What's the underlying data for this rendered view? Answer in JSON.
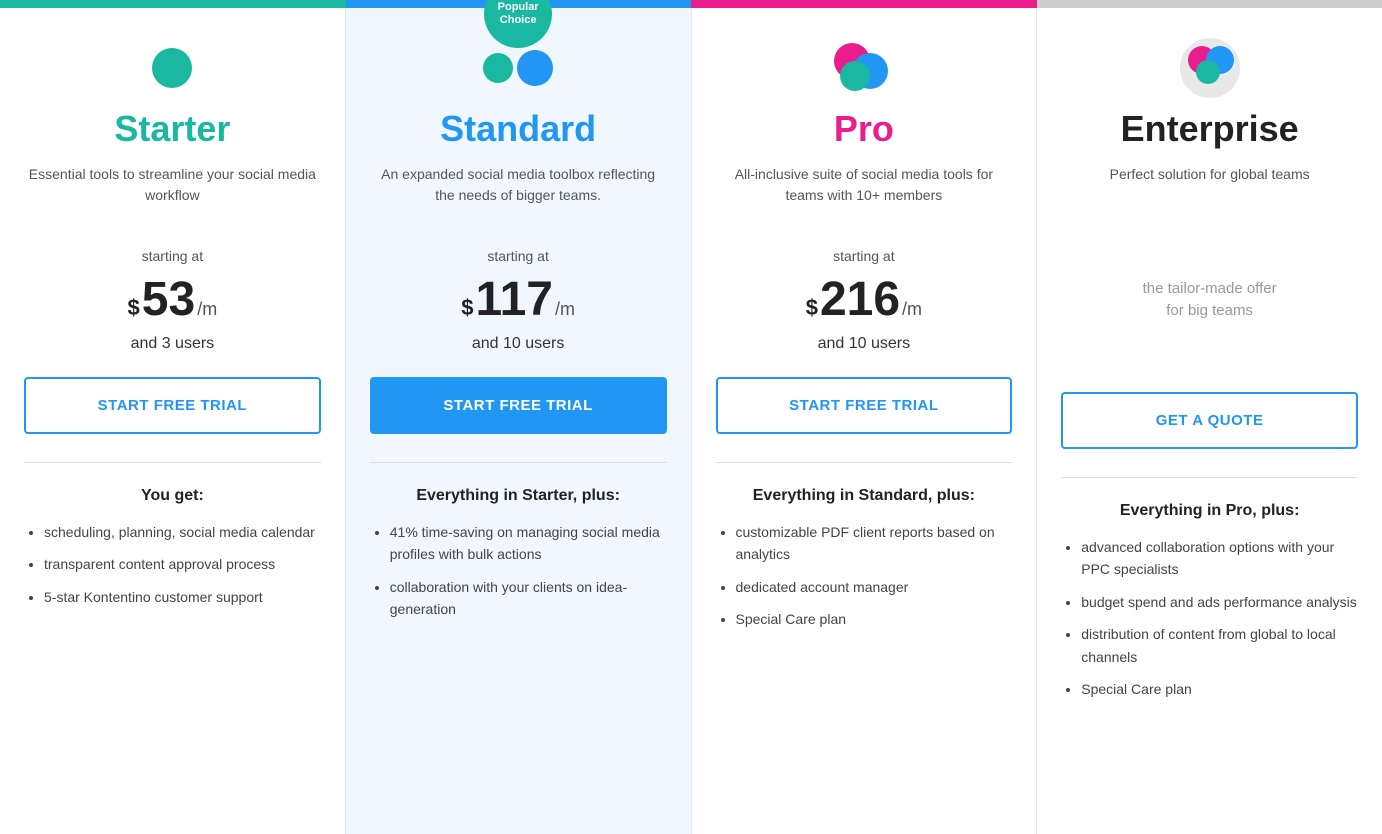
{
  "topBar": {
    "segments": [
      {
        "color": "#1ab8a0"
      },
      {
        "color": "#2196f3"
      },
      {
        "color": "#e91e8c"
      },
      {
        "color": "#cccccc"
      }
    ]
  },
  "popularBadge": {
    "line1": "Popular",
    "line2": "Choice"
  },
  "plans": [
    {
      "id": "starter",
      "name": "Starter",
      "nameColor": "#1ab8a0",
      "description": "Essential tools to streamline your social media workflow",
      "startingAt": "starting at",
      "currency": "$",
      "price": "53",
      "period": "/m",
      "users": "and 3 users",
      "ctaLabel": "START FREE TRIAL",
      "ctaStyle": "outline",
      "featuresHeader": "You get:",
      "features": [
        "scheduling, planning, social media calendar",
        "transparent content approval process",
        "5-star Kontentino customer support"
      ]
    },
    {
      "id": "standard",
      "name": "Standard",
      "nameColor": "#2196f3",
      "description": "An expanded social media toolbox reflecting the needs of bigger teams.",
      "startingAt": "starting at",
      "currency": "$",
      "price": "117",
      "period": "/m",
      "users": "and 10 users",
      "ctaLabel": "START FREE TRIAL",
      "ctaStyle": "filled",
      "featuresHeader": "Everything in Starter, plus:",
      "features": [
        "41% time-saving on managing social media profiles with bulk actions",
        "collaboration with your clients on idea-generation"
      ]
    },
    {
      "id": "pro",
      "name": "Pro",
      "nameColor": "#e91e8c",
      "description": "All-inclusive suite of social media tools for teams with 10+ members",
      "startingAt": "starting at",
      "currency": "$",
      "price": "216",
      "period": "/m",
      "users": "and 10 users",
      "ctaLabel": "START FREE TRIAL",
      "ctaStyle": "outline",
      "featuresHeader": "Everything in Standard, plus:",
      "features": [
        "customizable PDF client reports based on analytics",
        "dedicated account manager",
        "Special Care plan"
      ]
    },
    {
      "id": "enterprise",
      "name": "Enterprise",
      "nameColor": "#222222",
      "description": "Perfect solution for global teams",
      "tailorText": "the tailor-made offer\nfor big teams",
      "ctaLabel": "GET A QUOTE",
      "ctaStyle": "get-quote",
      "featuresHeader": "Everything in Pro, plus:",
      "features": [
        "advanced collaboration options with your PPC specialists",
        "budget spend and ads performance analysis",
        "distribution of content from global to local channels",
        "Special Care plan"
      ]
    }
  ]
}
